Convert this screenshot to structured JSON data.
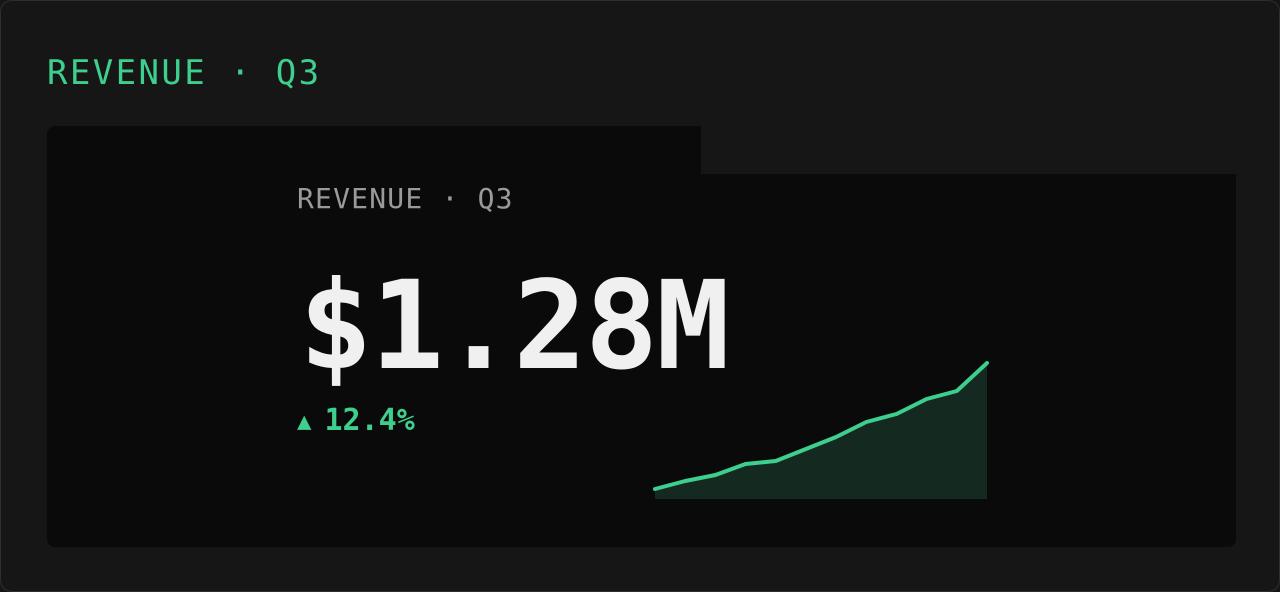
{
  "theme": {
    "accent": "#3ecf8e",
    "area_fill": "#142a21",
    "text_primary": "#f0f0f0",
    "text_muted": "#9a9a9a",
    "panel_bg": "#161616",
    "card_bg": "#0a0a0a"
  },
  "panel": {
    "title": "REVENUE · Q3"
  },
  "card": {
    "label": "REVENUE · Q3",
    "value": "$1.28M",
    "delta": {
      "arrow_icon": "triangle-up-icon",
      "arrow_glyph": "▲",
      "text": "12.4%"
    }
  },
  "chart_data": {
    "type": "area",
    "values": [
      1.0,
      1.8,
      2.4,
      3.5,
      3.8,
      5.0,
      6.2,
      7.7,
      8.5,
      10.0,
      10.8,
      13.6
    ]
  }
}
